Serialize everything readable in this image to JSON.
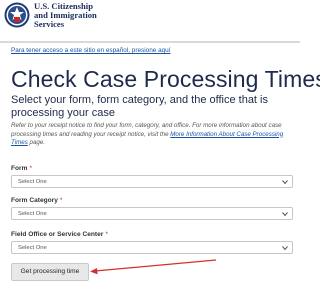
{
  "header": {
    "agency_line1": "U.S. Citizenship",
    "agency_line2": "and Immigration",
    "agency_line3": "Services",
    "seal_icon": "dhs-seal-icon"
  },
  "spanish_link": "Para tener acceso a este sitio en español, presione aquí",
  "page_title": "Check Case Processing Times",
  "subtitle": "Select your form, form category, and the office that is processing your case",
  "help": {
    "text_before": "Refer to your receipt notice to find your form, category, and office. For more information about case processing times and reading your receipt notice, visit the ",
    "link_text": "More Information About Case Processing Times",
    "text_after": " page."
  },
  "form": {
    "form_label": "Form",
    "form_value": "Select One",
    "category_label": "Form Category",
    "category_value": "Select One",
    "office_label": "Field Office or Service Center",
    "office_value": "Select One",
    "required_mark": "*",
    "submit_label": "Get processing time"
  },
  "colors": {
    "title": "#1d2a4a",
    "link": "#1a52a3",
    "required": "#c62828",
    "annotation_arrow": "#d32f2f"
  }
}
